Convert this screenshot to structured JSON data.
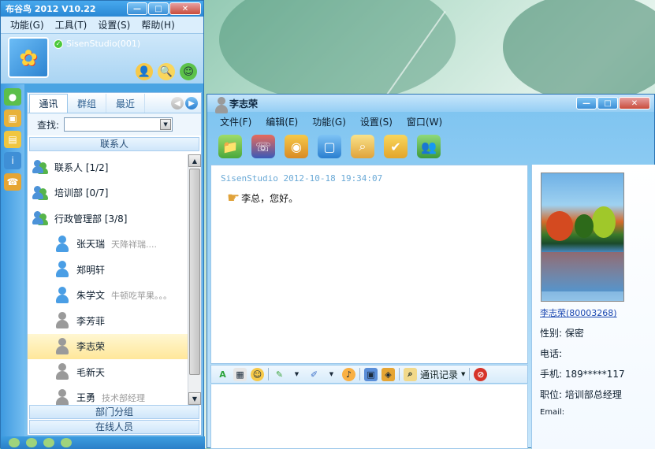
{
  "main": {
    "title": "布谷鸟 2012  V10.22",
    "menu": [
      "功能(G)",
      "工具(T)",
      "设置(S)",
      "帮助(H)"
    ],
    "user": {
      "name": "SisenStudio(001)"
    },
    "tabs": [
      "通讯",
      "群组",
      "最近"
    ],
    "search_label": "查找:",
    "search_value": "",
    "contacts_header": "联系人",
    "groups": [
      {
        "label": "联系人 [1/2]"
      },
      {
        "label": "培训部 [0/7]"
      },
      {
        "label": "行政管理部 [3/8]"
      }
    ],
    "people": [
      {
        "name": "张天瑞",
        "signature": "天降祥瑞....",
        "online": true
      },
      {
        "name": "郑明轩",
        "signature": "",
        "online": true
      },
      {
        "name": "朱学文",
        "signature": "牛顿吃苹果。。。",
        "online": true
      },
      {
        "name": "李芳菲",
        "signature": "",
        "online": false
      },
      {
        "name": "李志荣",
        "signature": "",
        "online": false,
        "selected": true
      },
      {
        "name": "毛新天",
        "signature": "",
        "online": false
      },
      {
        "name": "王勇",
        "signature": "技术部经理",
        "online": false
      }
    ],
    "footer_buttons": [
      "部门分组",
      "在线人员"
    ]
  },
  "chat": {
    "title": "李志荣",
    "menu": [
      "文件(F)",
      "编辑(E)",
      "功能(G)",
      "设置(S)",
      "窗口(W)"
    ],
    "message": {
      "sender_time": "SisenStudio 2012-10-18 19:34:07",
      "text": "李总，您好。"
    },
    "input_toolbar": {
      "history_label": "通讯记录"
    },
    "profile": {
      "name_link": "李志荣(80003268)",
      "gender": "性别:  保密",
      "phone": "电话:",
      "mobile": "手机:  189*****117",
      "position": "职位:  培训部总经理",
      "email": "Email:"
    }
  },
  "colors": {
    "window_blue": "#3d9de0",
    "selected_row": "#ffe79a",
    "online_icon": "#4a9ee5",
    "offline_icon": "#9a9a9a"
  }
}
